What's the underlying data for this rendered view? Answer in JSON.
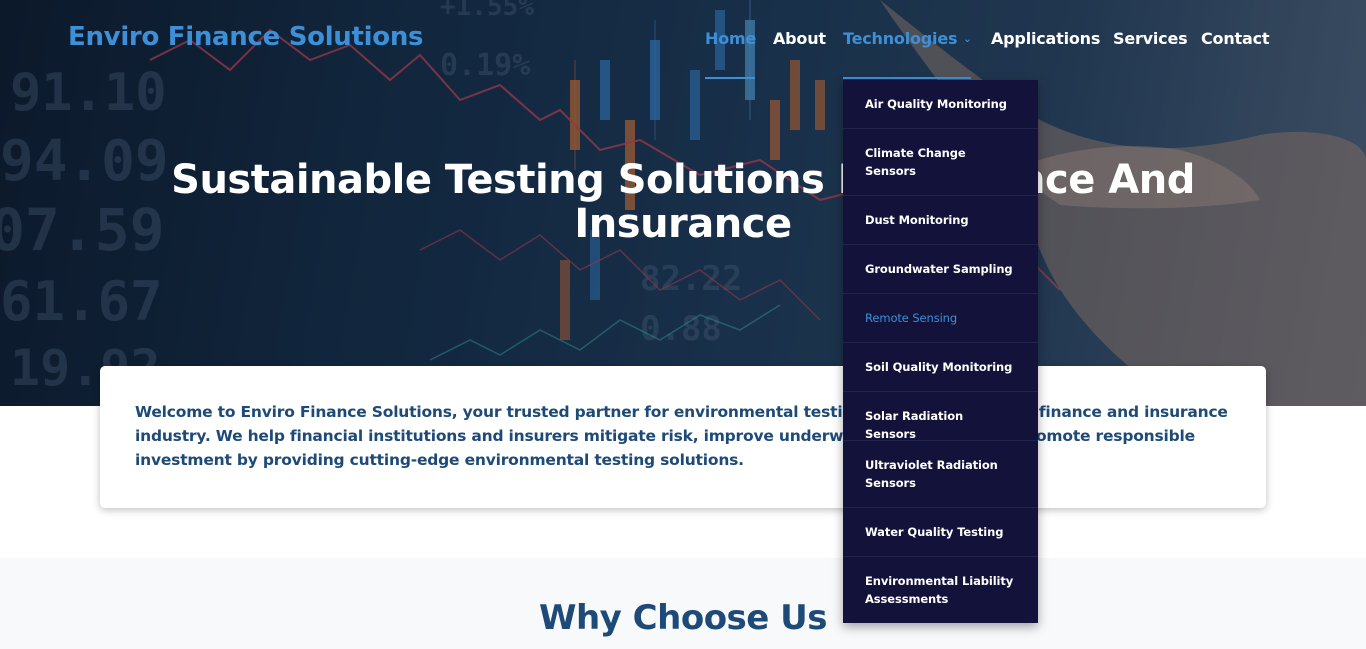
{
  "brand": {
    "name": "Enviro Finance Solutions",
    "accent": "#3d8fd8",
    "dark_text": "#1e4a78",
    "menu_bg": "#12123a"
  },
  "nav": {
    "home": "Home",
    "about": "About",
    "technologies": "Technologies",
    "applications": "Applications",
    "services": "Services",
    "contact": "Contact",
    "chevron_icon": "chevron-down-icon"
  },
  "hero": {
    "title": "Sustainable Testing Solutions For Finance And Insurance"
  },
  "intro": {
    "text": "Welcome to Enviro Finance Solutions, your trusted partner for environmental testing technologies in the finance and insurance industry. We help financial institutions and insurers mitigate risk, improve underwriting accuracy, and promote responsible investment by providing cutting-edge environmental testing solutions."
  },
  "why": {
    "title": "Why Choose Us"
  },
  "dropdown": {
    "items": [
      "Air Quality Monitoring",
      "Climate Change Sensors",
      "Dust Monitoring",
      "Groundwater Sampling",
      "Remote Sensing",
      "Soil Quality Monitoring",
      "Solar Radiation Sensors",
      "Ultraviolet Radiation Sensors",
      "Water Quality Testing",
      "Environmental Liability Assessments"
    ],
    "hovered": "Remote Sensing"
  }
}
